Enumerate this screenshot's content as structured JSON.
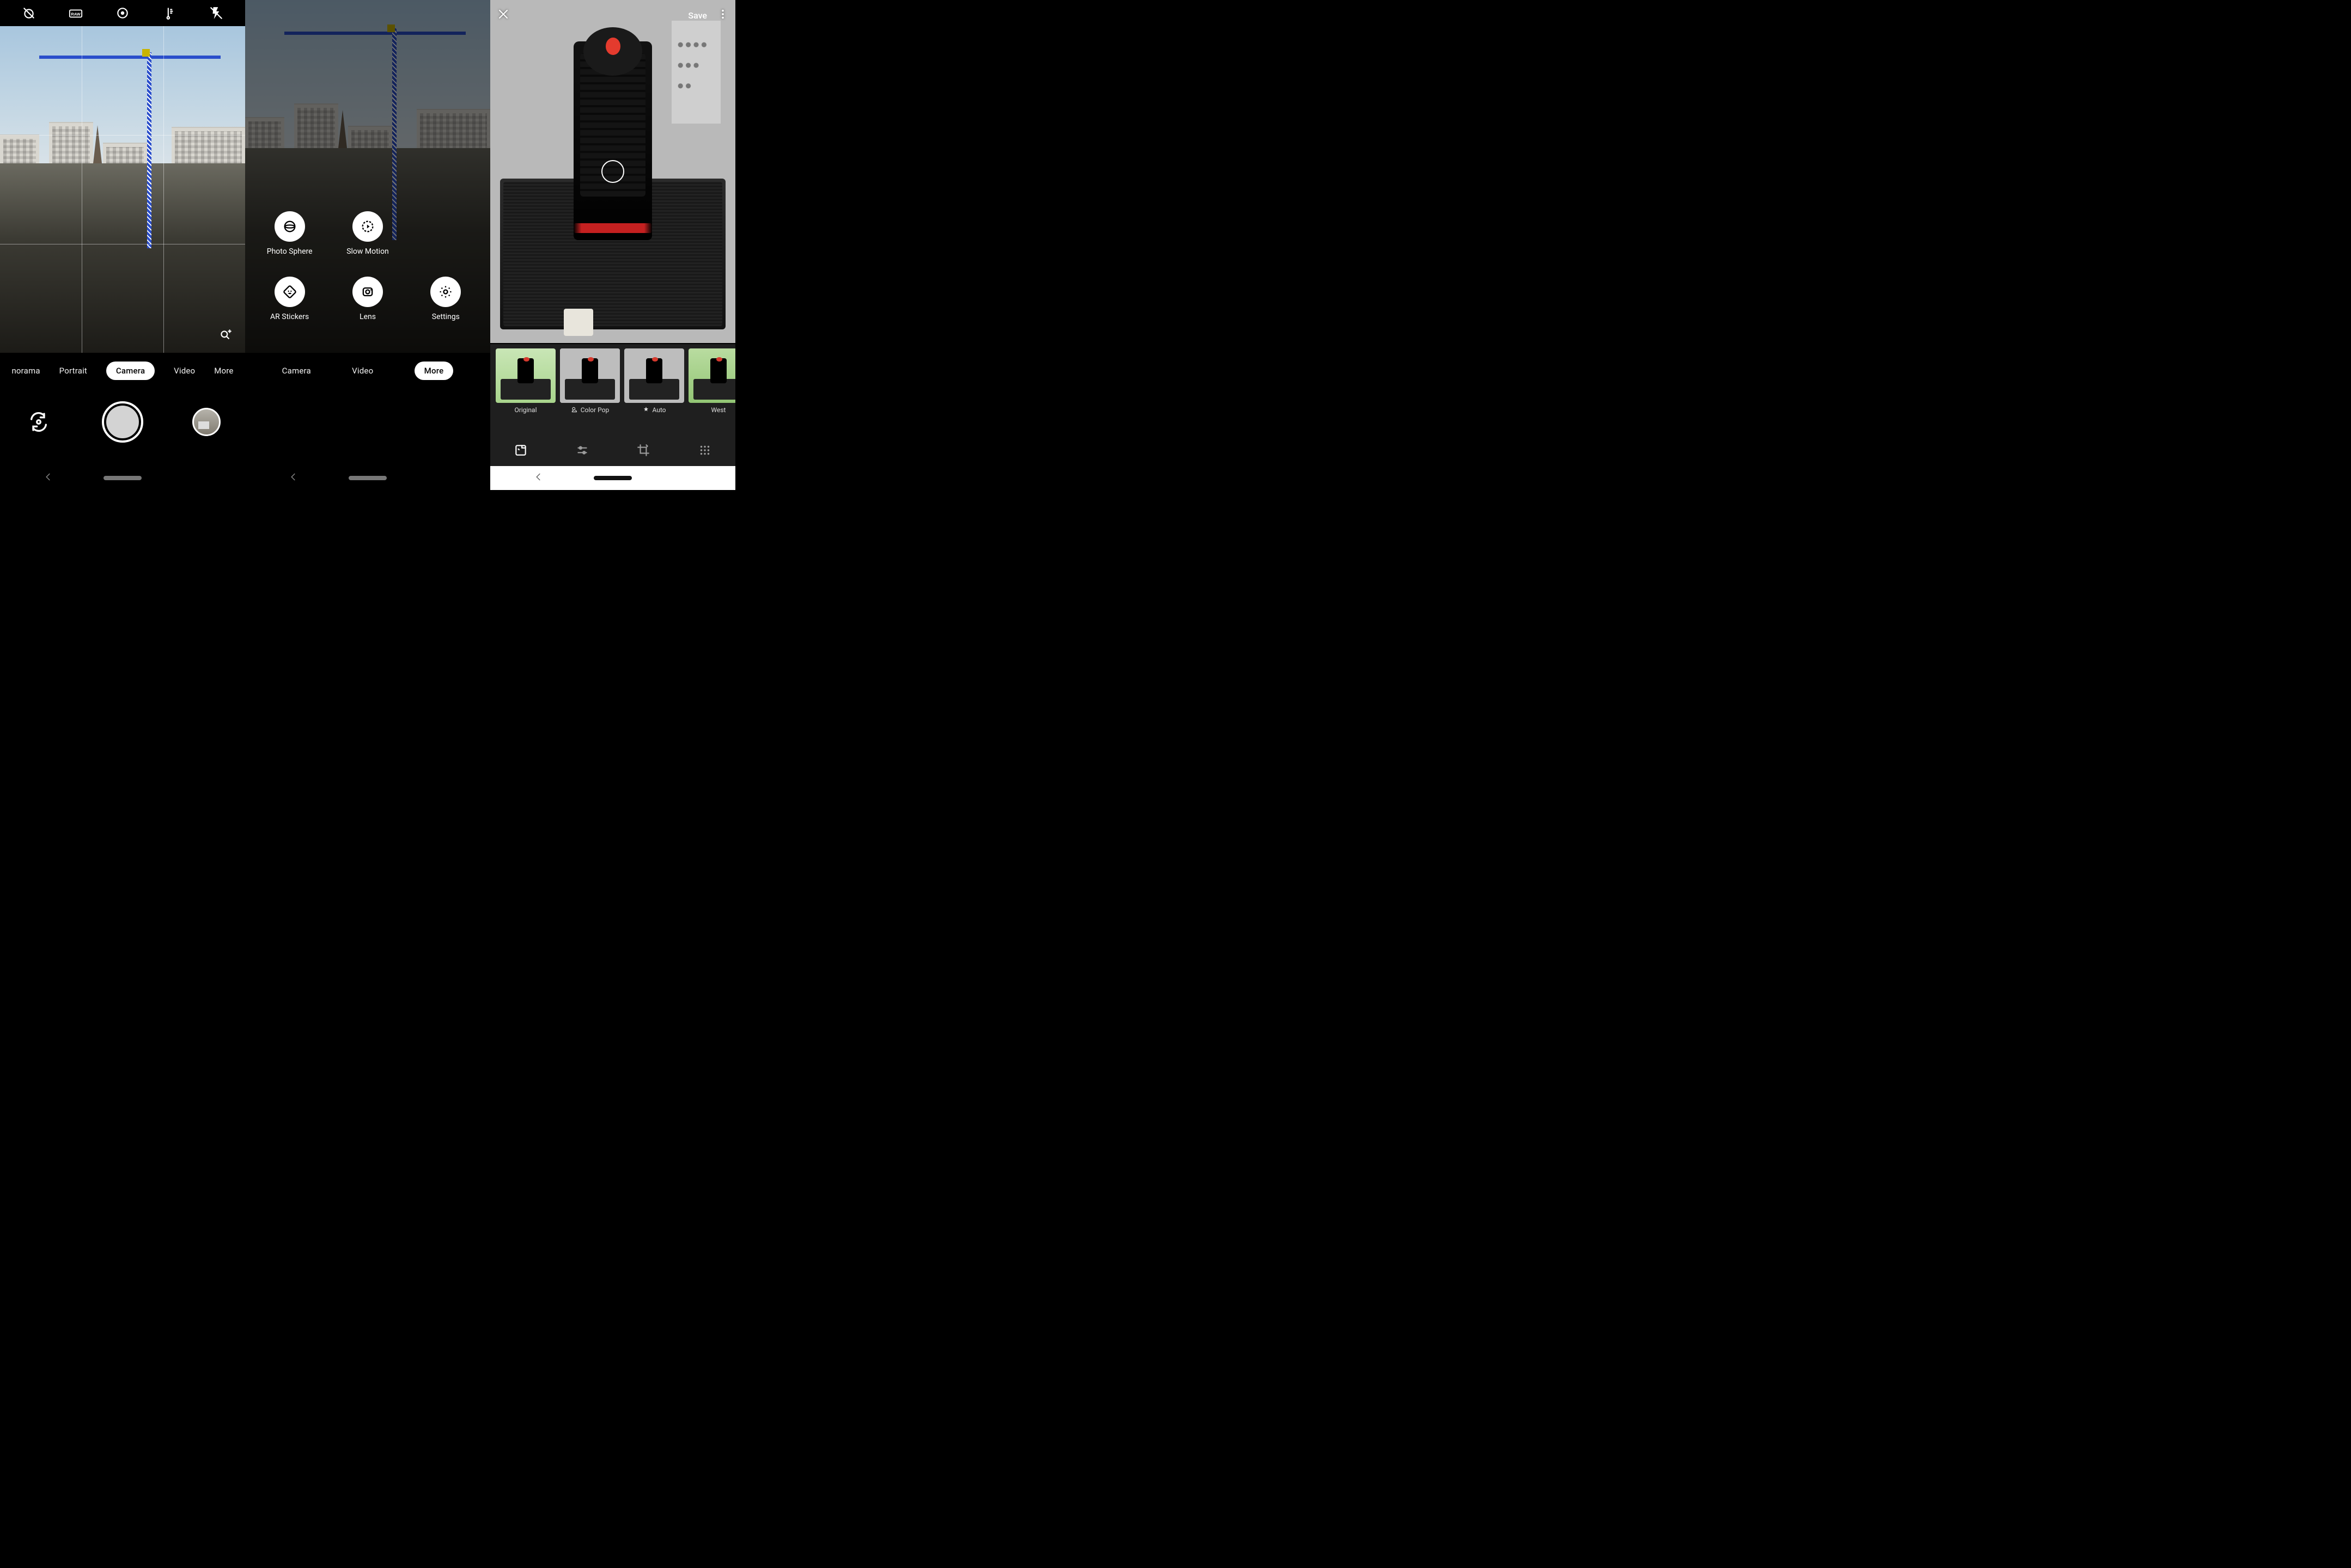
{
  "panel1": {
    "top_icons": [
      "timer-off-icon",
      "raw-icon",
      "motion-photo-icon",
      "white-balance-icon",
      "flash-off-icon"
    ],
    "modes": [
      "norama",
      "Portrait",
      "Camera",
      "Video",
      "More"
    ],
    "active_mode": "Camera",
    "focus_icon": "focus-icon",
    "controls": {
      "switch": "switch-camera-icon",
      "shutter": "shutter-button",
      "thumbnail": "last-photo-thumb"
    }
  },
  "panel2": {
    "modes": [
      "Camera",
      "Video",
      "More"
    ],
    "active_mode": "More",
    "more_items": [
      {
        "label": "Photo Sphere",
        "icon": "photo-sphere-icon"
      },
      {
        "label": "Slow Motion",
        "icon": "slow-motion-icon"
      },
      {
        "label": "",
        "icon": ""
      },
      {
        "label": "AR Stickers",
        "icon": "ar-stickers-icon"
      },
      {
        "label": "Lens",
        "icon": "lens-icon"
      },
      {
        "label": "Settings",
        "icon": "settings-icon"
      }
    ]
  },
  "panel3": {
    "close": "close-icon",
    "save": "Save",
    "overflow": "overflow-icon",
    "filters": [
      {
        "label": "Original",
        "icon": ""
      },
      {
        "label": "Color Pop",
        "icon": "color-pop-icon"
      },
      {
        "label": "Auto",
        "icon": "auto-icon"
      },
      {
        "label": "West",
        "icon": ""
      }
    ],
    "selected_filter": "Color Pop",
    "tools": [
      "filters-icon",
      "adjust-icon",
      "crop-rotate-icon",
      "grid-extend-icon"
    ],
    "active_tool": "filters-icon"
  }
}
